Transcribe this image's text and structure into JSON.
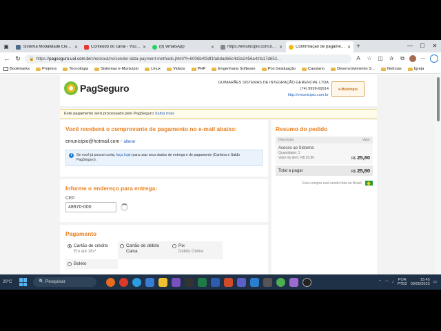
{
  "browser": {
    "tabs": [
      {
        "label": "Sistema Modalidade Eletrônica",
        "color": "#4d6b8a",
        "active": false
      },
      {
        "label": "Conteúdo do canal - YouTube",
        "color": "#e53935",
        "active": false
      },
      {
        "label": "(8) WhatsApp",
        "color": "#25d366",
        "active": false
      },
      {
        "label": "https://emunicipio.com.br/pro",
        "color": "#888888",
        "active": false
      },
      {
        "label": "Confirmação de pagamento",
        "color": "#f3b914",
        "active": true
      }
    ],
    "url": {
      "prefix": "https://",
      "host": "pagseguro.uol.com.br",
      "path": "/checkout/nc/sender-data-payment-methods.jhtml?t=6006b4f3df1fabdadb6c4d3a2456a4zfa17d652..."
    },
    "bookmarks": [
      {
        "label": "Bookmarks",
        "type": "icon"
      },
      {
        "label": "Projetos",
        "type": "folder"
      },
      {
        "label": "Tecnologia",
        "type": "folder"
      },
      {
        "label": "Sistemas e-Municipio",
        "type": "folder"
      },
      {
        "label": "Linux",
        "type": "folder"
      },
      {
        "label": "Videos",
        "type": "folder"
      },
      {
        "label": "PHP",
        "type": "folder"
      },
      {
        "label": "Engenharia Software",
        "type": "folder"
      },
      {
        "label": "Pós Graduação",
        "type": "folder"
      },
      {
        "label": "Cassiano",
        "type": "folder"
      },
      {
        "label": "Desenvolvimento S...",
        "type": "folder"
      },
      {
        "label": "Notícias",
        "type": "folder"
      },
      {
        "label": "Igreja",
        "type": "folder"
      }
    ]
  },
  "header": {
    "logo_text": "PagSeguro",
    "merchant_name": "GUIMARÃES SISTEMAS DE INTEGRAÇÃO GERENCIAL LTDA",
    "merchant_phone": "(74) 9999-69914",
    "merchant_url": "http://emunicipio.com.br",
    "merchant_logo": "e-Municipio"
  },
  "notice": {
    "text": "Este pagamento será processado pelo PagSeguro",
    "link": "Saiba mais"
  },
  "receipt": {
    "title": "Você receberá o comprovante de pagamento no e-mail abaixo:",
    "email": "emunicipio@hotmail.com",
    "change_link": "alterar",
    "info_pre": "Se você já possui conta,",
    "info_link": "faça login",
    "info_post": "para usar seus dados de entrega e de pagamento (Carteira e Saldo PagSeguro)."
  },
  "address": {
    "title": "Informe o endereço para entrega:",
    "cep_label": "CEP",
    "cep_value": "48970-000"
  },
  "payment": {
    "title": "Pagamento",
    "options": [
      {
        "label": "Cartão de crédito",
        "sub": "Em até 18x*",
        "selected": true
      },
      {
        "label": "Cartão de débito",
        "sub": "Caixa",
        "selected": false
      },
      {
        "label": "Pix",
        "sub": "Débito Online",
        "selected": false
      }
    ],
    "boleto": "Boleto"
  },
  "summary": {
    "title": "Resumo do pedido",
    "col_desc": "Descrição",
    "col_value": "Valor",
    "item_name": "Acesso ao Sistema",
    "item_qty": "Quantidade: 1",
    "item_unit": "Valor do item: R$ 25,80",
    "item_currency": "R$",
    "item_price": "25,80",
    "total_label": "Total a pagar",
    "total_currency": "R$",
    "total_price": "25,80",
    "brazil_note": "Esta compra está sendo feita no Brasil."
  },
  "taskbar": {
    "weather": "20°C",
    "search": "Pesquisar",
    "lang_1": "POR",
    "lang_2": "PTB2",
    "time": "15:45",
    "date": "09/05/2023"
  }
}
